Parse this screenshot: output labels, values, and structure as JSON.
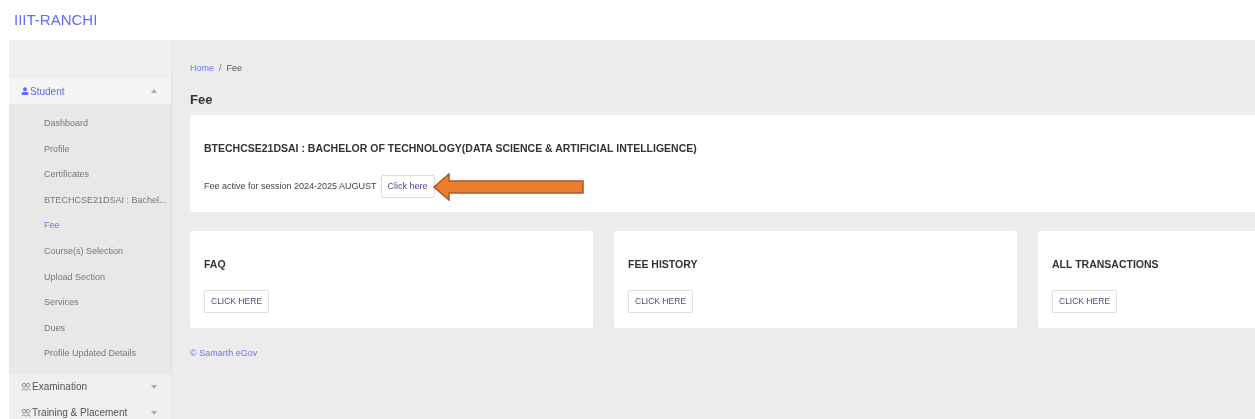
{
  "header": {
    "brand": "IIIT-RANCHI"
  },
  "sidebar": {
    "groups": [
      {
        "label": "Student",
        "expanded": true,
        "items": [
          {
            "label": "Dashboard",
            "selected": false
          },
          {
            "label": "Profile",
            "selected": false
          },
          {
            "label": "Certificates",
            "selected": false
          },
          {
            "label": "BTECHCSE21DSAI : Bachel...",
            "selected": false
          },
          {
            "label": "Fee",
            "selected": true
          },
          {
            "label": "Course(s) Selection",
            "selected": false
          },
          {
            "label": "Upload Section",
            "selected": false
          },
          {
            "label": "Services",
            "selected": false
          },
          {
            "label": "Dues",
            "selected": false
          },
          {
            "label": "Profile Updated Details",
            "selected": false
          }
        ]
      },
      {
        "label": "Examination",
        "expanded": false
      },
      {
        "label": "Training & Placement",
        "expanded": false
      }
    ]
  },
  "breadcrumb": [
    {
      "label": "Home",
      "kind": "link"
    },
    {
      "label": "/",
      "kind": "separator"
    },
    {
      "label": "Fee",
      "kind": "current"
    }
  ],
  "page_title": "Fee",
  "program_card": {
    "title": "BTECHCSE21DSAI : BACHELOR OF TECHNOLOGY(DATA SCIENCE & ARTIFICIAL INTELLIGENCE)",
    "session_text": "Fee active for session 2024-2025 AUGUST",
    "button": "Click here",
    "annotation_arrow": true
  },
  "cards": [
    {
      "title": "FAQ",
      "button": "CLICK HERE"
    },
    {
      "title": "FEE HISTORY",
      "button": "CLICK HERE"
    },
    {
      "title": "ALL TRANSACTIONS",
      "button": "CLICK HERE"
    }
  ],
  "footer": "© Samarth eGov"
}
